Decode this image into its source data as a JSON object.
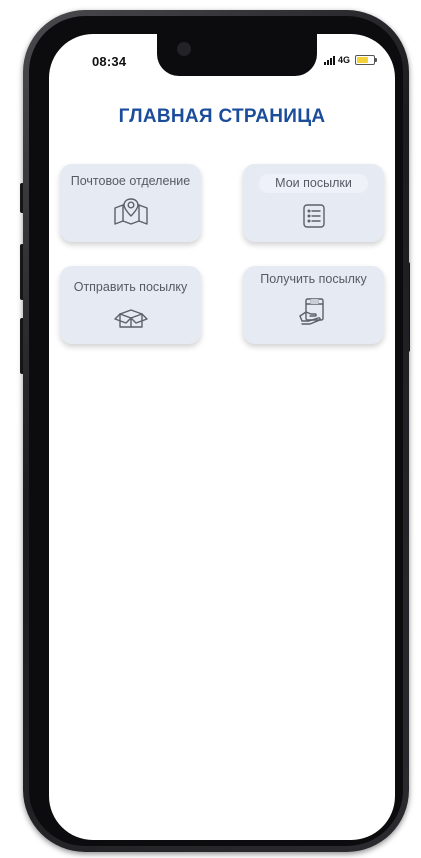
{
  "status_bar": {
    "time": "08:34",
    "network": "4G",
    "signal_icon": "signal-bars-icon",
    "battery_icon": "battery-icon",
    "battery_level": 0.6,
    "battery_color": "#f4d23a"
  },
  "header": {
    "title": "ГЛАВНАЯ СТРАНИЦА",
    "title_color": "#1c4d9b"
  },
  "menu": {
    "items": [
      {
        "label": "Почтовое отделение",
        "icon": "map-pin-icon"
      },
      {
        "label": "Мои посылки",
        "icon": "list-icon"
      },
      {
        "label": "Отправить посылку",
        "icon": "open-box-icon"
      },
      {
        "label": "Получить посылку",
        "icon": "package-pickup-icon"
      }
    ],
    "card_color": "#e6eaf3"
  }
}
